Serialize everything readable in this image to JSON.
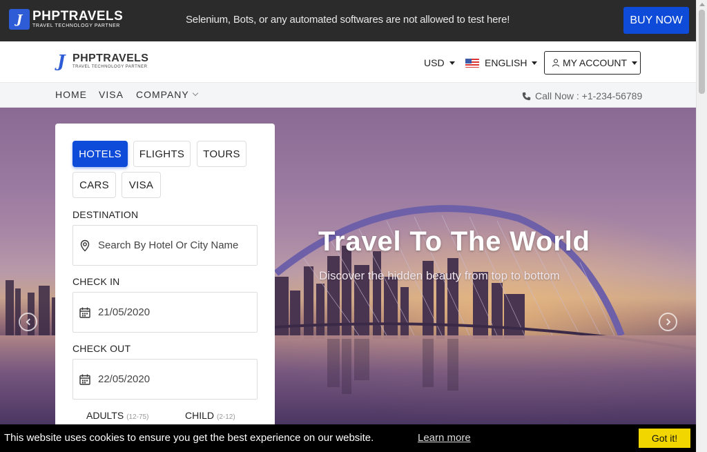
{
  "topbar": {
    "logo_name": "PHPTRAVELS",
    "logo_tagline": "TRAVEL TECHNOLOGY PARTNER",
    "notice": "Selenium, Bots, or any automated softwares are not allowed to test here!",
    "buy_now": "BUY NOW"
  },
  "header": {
    "logo_name": "PHPTRAVELS",
    "logo_tagline": "TRAVEL TECHNOLOGY PARTNER",
    "currency": "USD",
    "language": "ENGLISH",
    "account": "MY ACCOUNT"
  },
  "nav": {
    "items": [
      "HOME",
      "VISA",
      "COMPANY"
    ],
    "call": "Call Now : +1-234-56789"
  },
  "hero": {
    "title": "Travel To The World",
    "subtitle": "Discover the hidden beauty from top to bottom"
  },
  "search": {
    "tabs": [
      "HOTELS",
      "FLIGHTS",
      "TOURS",
      "CARS",
      "VISA"
    ],
    "active_tab": "HOTELS",
    "destination_label": "DESTINATION",
    "destination_placeholder": "Search By Hotel Or City Name",
    "checkin_label": "CHECK IN",
    "checkin_value": "21/05/2020",
    "checkout_label": "CHECK OUT",
    "checkout_value": "22/05/2020",
    "adults_label": "ADULTS",
    "adults_range": "(12-75)",
    "child_label": "CHILD",
    "child_range": "(2-12)"
  },
  "cookie": {
    "message": "This website uses cookies to ensure you get the best experience on our website.",
    "learn_more": "Learn more",
    "accept": "Got it!"
  },
  "colors": {
    "accent": "#0d4bd8",
    "topbar": "#2b2b2b",
    "cookie_button": "#f1d600"
  }
}
